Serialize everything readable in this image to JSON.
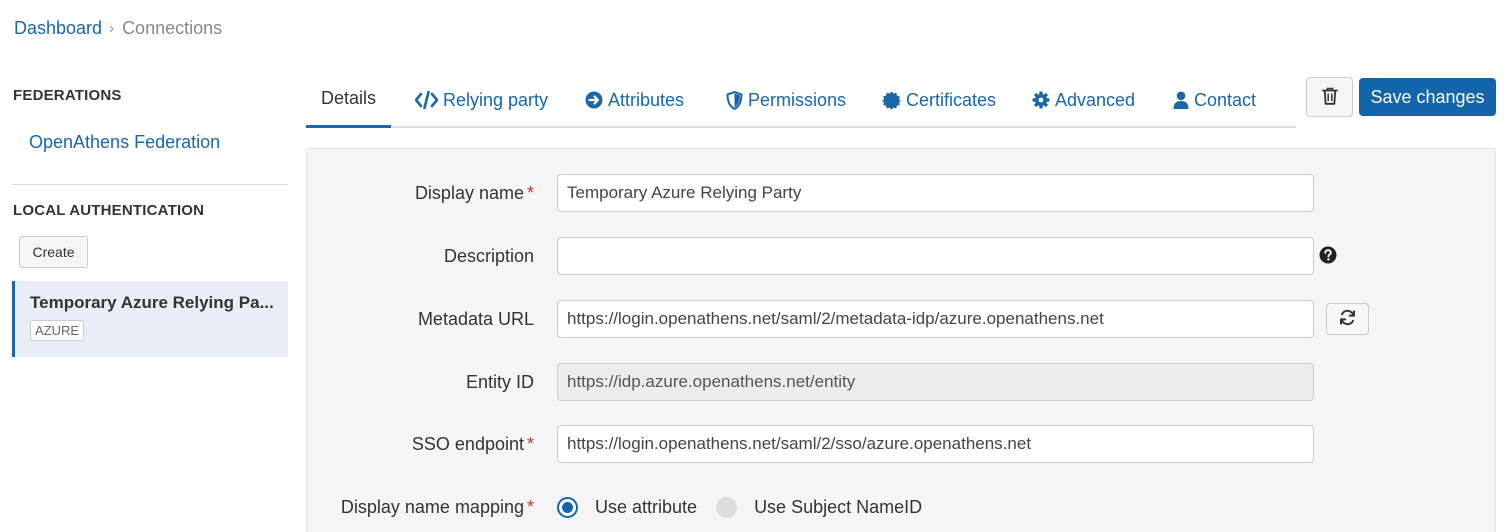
{
  "breadcrumb": {
    "home": "Dashboard",
    "separator": "›",
    "current": "Connections"
  },
  "sidebar": {
    "federations_heading": "FEDERATIONS",
    "federation_item": "OpenAthens Federation",
    "local_heading": "LOCAL AUTHENTICATION",
    "create_label": "Create",
    "selected": {
      "title": "Temporary Azure Relying Pa...",
      "badge": "AZURE"
    }
  },
  "tabs": [
    {
      "label": "Details",
      "icon": "none",
      "active": true
    },
    {
      "label": "Relying party",
      "icon": "code-icon"
    },
    {
      "label": "Attributes",
      "icon": "arrow-circle-right-icon"
    },
    {
      "label": "Permissions",
      "icon": "shield-icon"
    },
    {
      "label": "Certificates",
      "icon": "certificate-icon"
    },
    {
      "label": "Advanced",
      "icon": "gear-icon"
    },
    {
      "label": "Contact",
      "icon": "user-icon"
    }
  ],
  "actions": {
    "delete_icon": "trash-icon",
    "save_label": "Save changes"
  },
  "form": {
    "display_name": {
      "label": "Display name",
      "required": "*",
      "value": "Temporary Azure Relying Party"
    },
    "description": {
      "label": "Description",
      "value": "",
      "help_icon": "question-circle-icon"
    },
    "metadata_url": {
      "label": "Metadata URL",
      "value": "https://login.openathens.net/saml/2/metadata-idp/azure.openathens.net",
      "refresh_icon": "refresh-icon"
    },
    "entity_id": {
      "label": "Entity ID",
      "value": "https://idp.azure.openathens.net/entity"
    },
    "sso_endpoint": {
      "label": "SSO endpoint",
      "required": "*",
      "value": "https://login.openathens.net/saml/2/sso/azure.openathens.net"
    },
    "display_name_mapping": {
      "label": "Display name mapping",
      "required": "*",
      "option_attribute": "Use attribute",
      "option_subject": "Use Subject NameID",
      "selected": "Use attribute"
    }
  },
  "colors": {
    "link": "#1a66a8",
    "primary": "#1365ab",
    "required": "#c0392b"
  }
}
